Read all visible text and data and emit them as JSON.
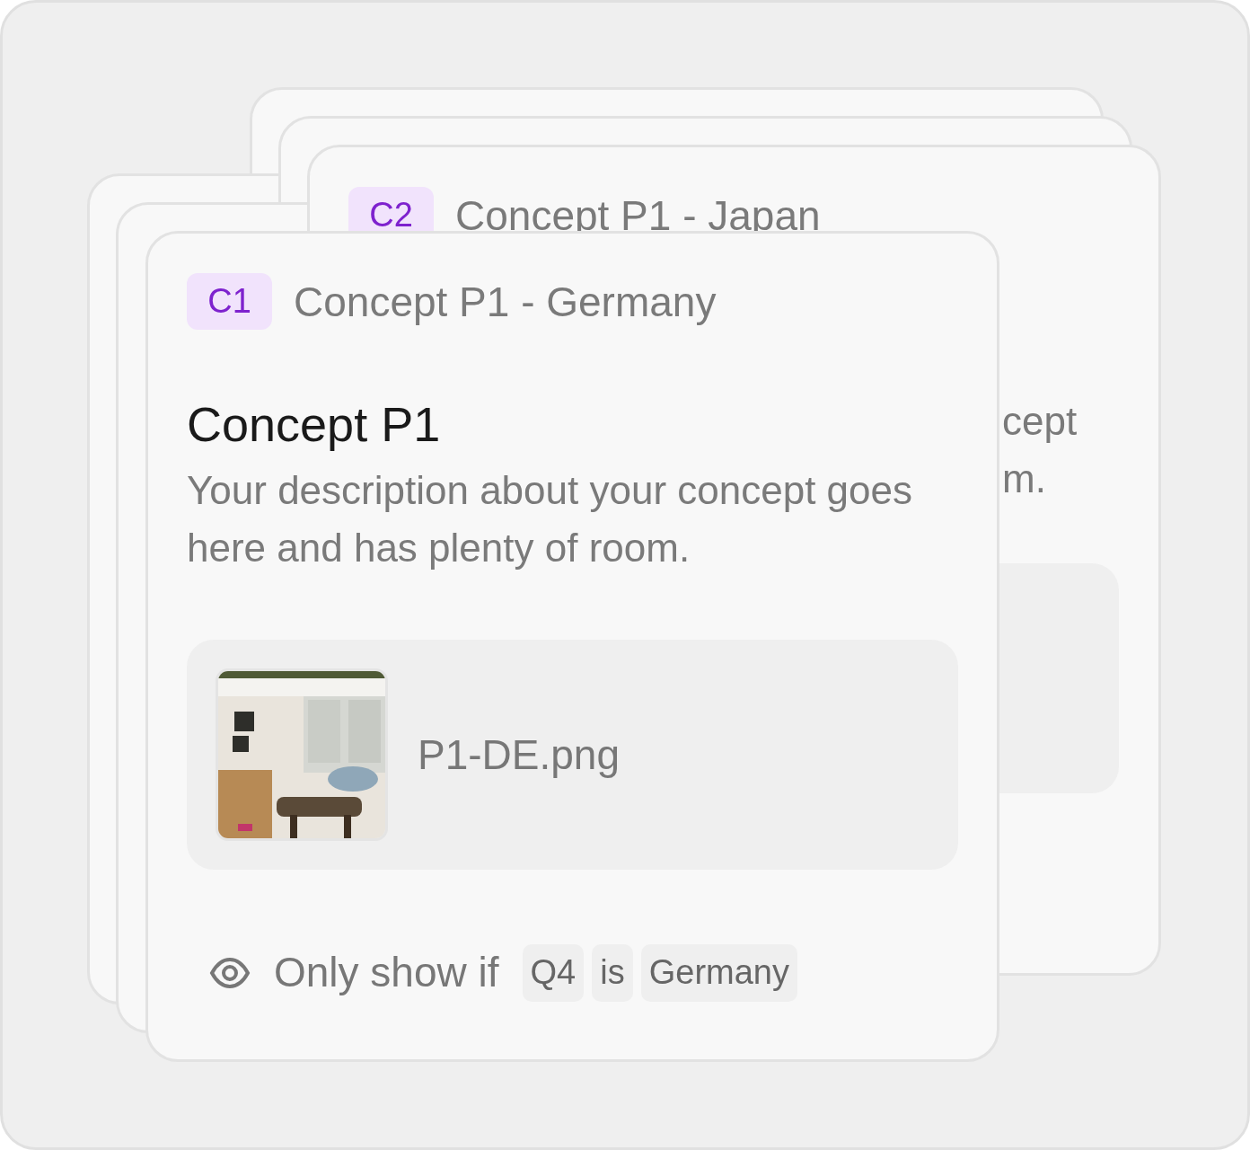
{
  "back_card": {
    "badge": "C2",
    "heading": "Concept P1 - Japan",
    "description_ends": [
      "cept",
      "m."
    ]
  },
  "front_card": {
    "badge": "C1",
    "heading": "Concept P1 - Germany",
    "title": "Concept P1",
    "description": "Your description about your concept goes here and has plenty of room.",
    "attachment": {
      "file_name": "P1-DE.png"
    },
    "condition": {
      "label": "Only show if",
      "tokens": [
        "Q4",
        "is",
        "Germany"
      ]
    }
  }
}
